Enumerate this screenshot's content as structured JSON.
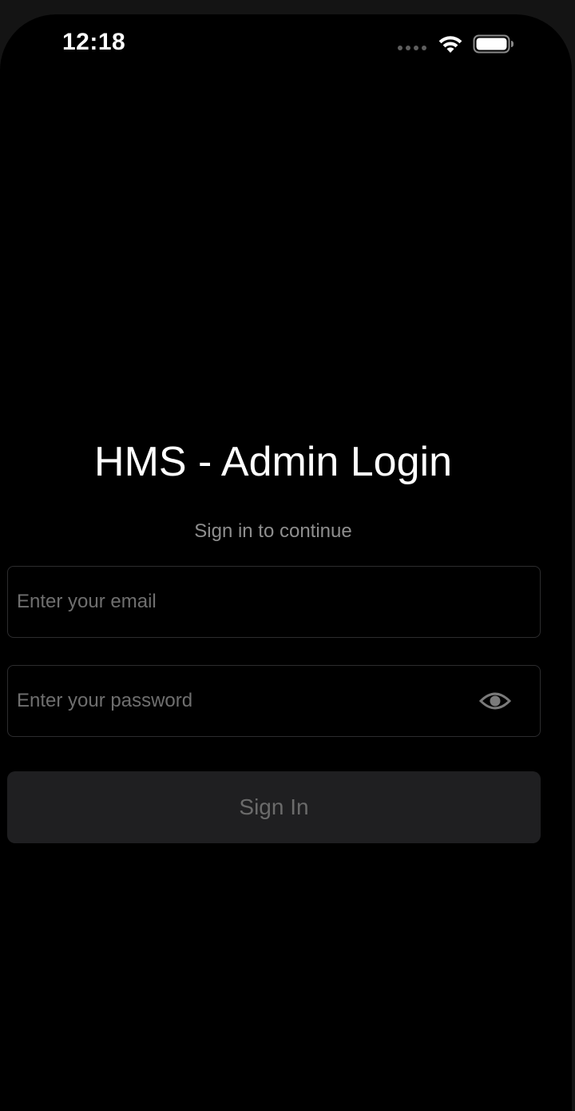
{
  "status_bar": {
    "time": "12:18",
    "icons": [
      "cellular-signal-icon",
      "wifi-icon",
      "battery-icon"
    ]
  },
  "login": {
    "title": "HMS - Admin Login",
    "subtitle": "Sign in to continue",
    "email": {
      "value": "",
      "placeholder": "Enter your email"
    },
    "password": {
      "value": "",
      "placeholder": "Enter your password",
      "toggle_icon": "eye-icon"
    },
    "sign_in_label": "Sign In"
  },
  "colors": {
    "background": "#000000",
    "title": "#ffffff",
    "subtitle": "#8e8e8e",
    "placeholder": "#6f6f6f",
    "field_border": "#2c2c2e",
    "button_background": "#1f1f21",
    "button_text": "#6b6b6b"
  }
}
